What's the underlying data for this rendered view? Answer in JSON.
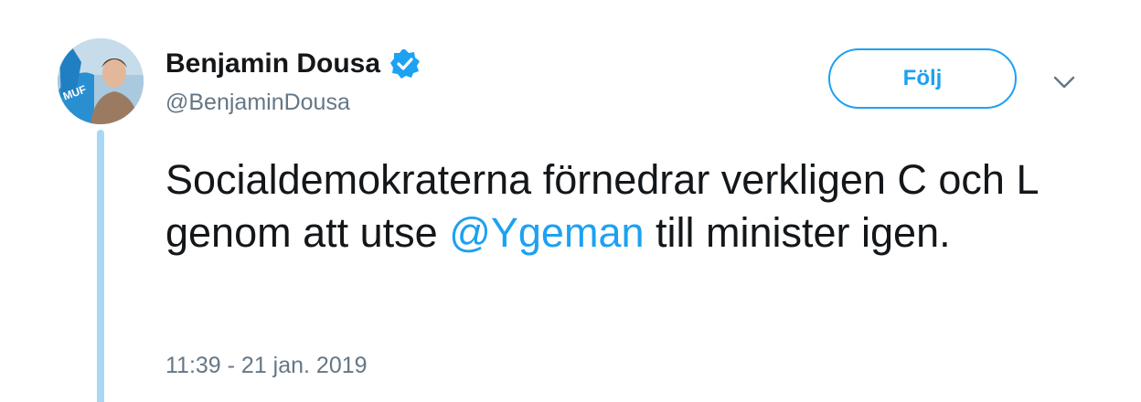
{
  "author": {
    "display_name": "Benjamin Dousa",
    "handle": "@BenjaminDousa"
  },
  "follow_button": {
    "label": "Följ"
  },
  "tweet": {
    "text_before": "Socialdemokraterna förnedrar verkligen C och L genom att utse ",
    "mention": "@Ygeman",
    "text_after": " till minister igen.",
    "timestamp": "11:39 - 21 jan. 2019"
  },
  "colors": {
    "accent": "#1da1f2",
    "thread_line": "#a8d8f4",
    "text": "#14171a",
    "muted": "#657786"
  },
  "icons": {
    "verified": "verified-badge-icon",
    "more": "chevron-down-icon"
  }
}
